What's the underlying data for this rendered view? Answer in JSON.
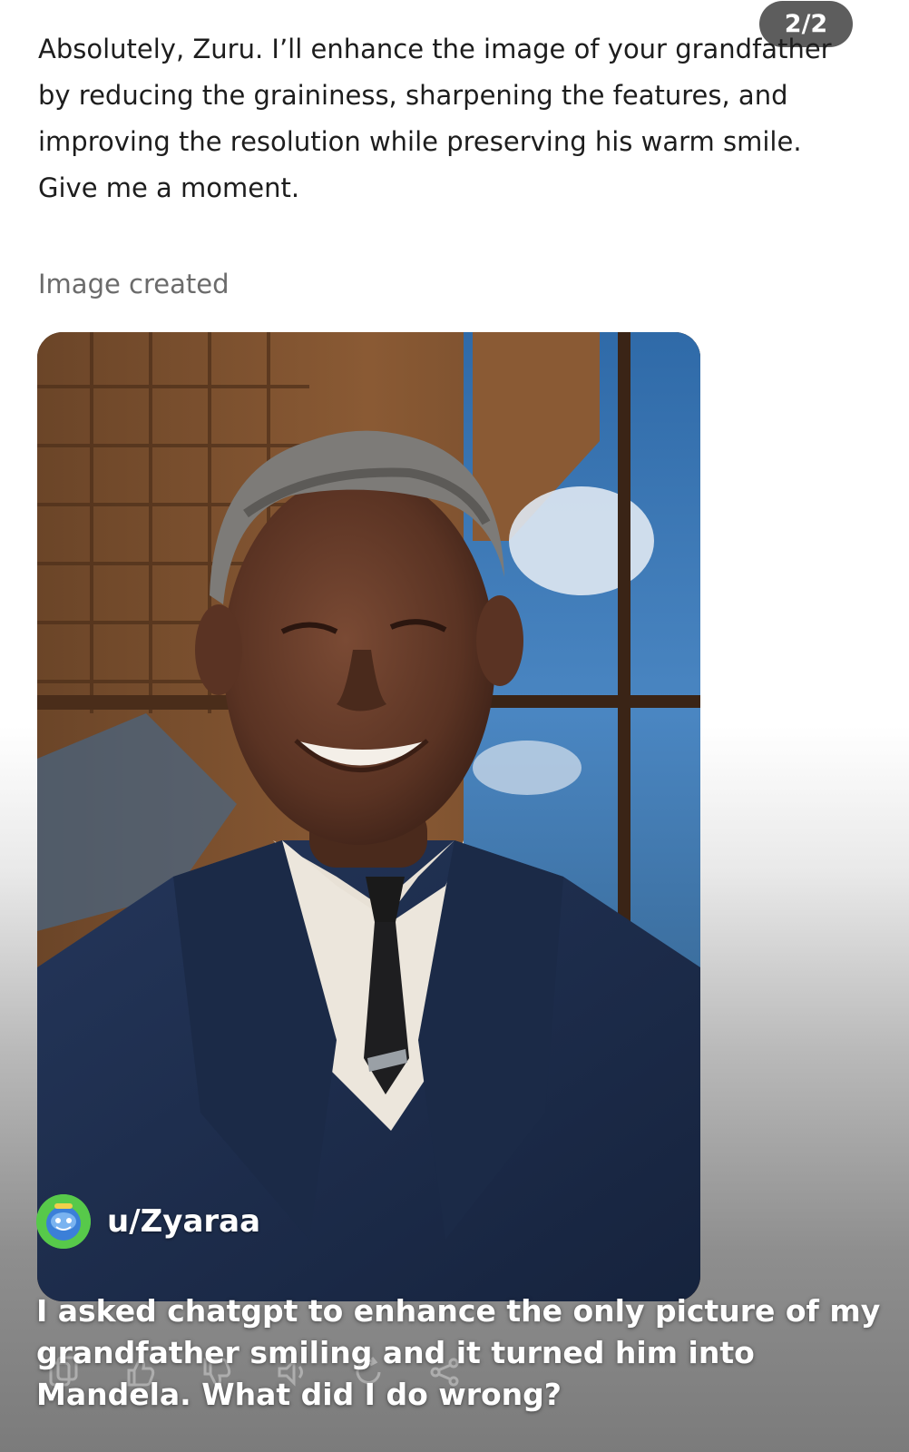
{
  "conversation": {
    "version_badge": "2/2",
    "assistant_message": "Absolutely, Zuru. I’ll enhance the image of your grandfather by reducing the graininess, sharpening the features, and improving the resolution while preserving his warm smile. Give me a moment.",
    "image_status": "Image created"
  },
  "post": {
    "username": "u/Zyaraa",
    "caption": "I asked chatgpt to enhance the only picture of my grandfather smiling and it turned him into Mandela. What did I do wrong?"
  },
  "message_actions": [
    "copy-icon",
    "thumbs-up-icon",
    "thumbs-down-icon",
    "read-aloud-icon",
    "regenerate-icon",
    "share-icon"
  ],
  "colors": {
    "badge_bg": "#5d5d5d",
    "suit_navy": "#1d2c48",
    "sky_blue": "#3f78b8",
    "avatar_green": "#57c94a"
  }
}
